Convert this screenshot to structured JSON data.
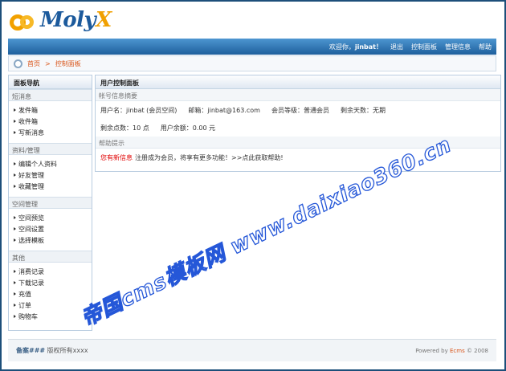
{
  "header": {
    "logo_text_main": "Moly",
    "logo_text_accent": "X"
  },
  "topnav": {
    "welcome": "欢迎你，",
    "username": "jinbat！",
    "items": [
      "退出",
      "控制面板",
      "管理信息",
      "帮助"
    ]
  },
  "breadcrumb": {
    "home": "首页",
    "sep": ">",
    "current": "控制面板"
  },
  "sidebar": {
    "title": "面板导航",
    "groups": [
      {
        "title": "短消息",
        "items": [
          "发件箱",
          "收件箱",
          "写新消息"
        ]
      },
      {
        "title": "资料/管理",
        "items": [
          "编辑个人资料",
          "好友管理",
          "收藏管理"
        ]
      },
      {
        "title": "空间管理",
        "items": [
          "空间预览",
          "空间设置",
          "选择模板"
        ]
      },
      {
        "title": "其他",
        "items": [
          "消费记录",
          "下载记录",
          "充值",
          "订单",
          "购物车"
        ]
      }
    ]
  },
  "main": {
    "title": "用户控制面板",
    "account_section": "帐号信息摘要",
    "username": "用户名：jinbat (会员空间)",
    "email": "邮箱：jinbat@163.com",
    "level": "会员等级：普通会员",
    "expire": "剩余天数：无期",
    "points": "剩余点数：10 点",
    "balance": "用户余额：0.00 元",
    "help_section": "帮助提示",
    "tip_red": "您有新信息",
    "tip_text": "注册成为会员，将享有更多功能！>>点此获取帮助!"
  },
  "footer": {
    "left_bold": "备案###",
    "left_text": " 版权所有xxxx",
    "powered": "Powered by ",
    "brand": "Ecms",
    "copy": " © 2008"
  },
  "watermark": "帝国cms模板网 www.daixiao360.cn",
  "colors": {
    "nav_bar": "#1e5f9c",
    "crumb_text": "#d9551a",
    "tip_red": "#e00000",
    "logo_blue": "#1c5a9c",
    "logo_orange": "#f0a000"
  }
}
